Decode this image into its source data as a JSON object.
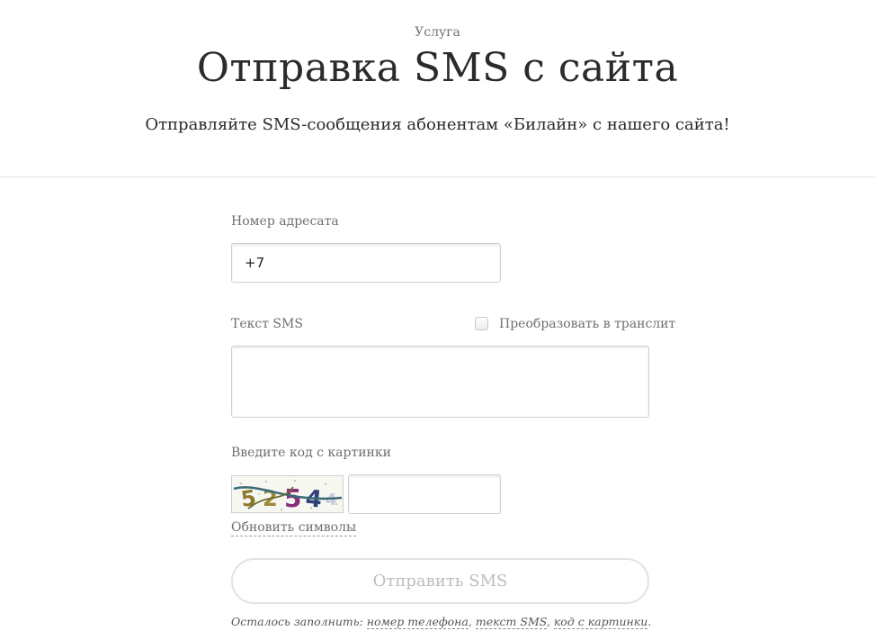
{
  "header": {
    "eyebrow": "Услуга",
    "title": "Отправка SMS с сайта",
    "subtitle": "Отправляйте SMS-сообщения абонентам «Билайн» с нашего сайта!"
  },
  "form": {
    "phone_label": "Номер адресата",
    "phone_value": "+7",
    "sms_label": "Текст SMS",
    "translit_label": "Преобразовать в транслит",
    "translit_checked": false,
    "captcha_label": "Введите код с картинки",
    "captcha_text": "5254",
    "refresh_label": "Обновить символы",
    "submit_label": "Отправить SMS",
    "remaining_prefix": "Осталось заполнить:",
    "remaining_phone": "номер телефона",
    "remaining_sms": "текст SMS",
    "remaining_captcha": "код с картинки",
    "sep1": ",",
    "sep2": ",",
    "end": "."
  },
  "colors": {
    "text": "#2b2b2b",
    "muted": "#6f6f6f",
    "border": "#cfcfcf",
    "button_text": "#bdbdbd"
  }
}
